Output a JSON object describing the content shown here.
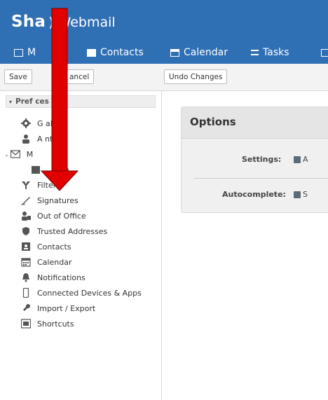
{
  "app": {
    "brand_part1": "Sha",
    "brand_part2": ") Webmail",
    "accent_color": "#2f6fb4",
    "arrow_color": "#e00000"
  },
  "nav": {
    "tabs": [
      {
        "label": "M",
        "icon": "envelope-icon"
      },
      {
        "label": "Contacts",
        "icon": "contact-card-icon"
      },
      {
        "label": "Calendar",
        "icon": "calendar-icon"
      },
      {
        "label": "Tasks",
        "icon": "tasks-icon"
      }
    ]
  },
  "toolbar": {
    "save_label": "Save",
    "cancel_label": "ancel",
    "undo_label": "Undo Changes"
  },
  "sidebar": {
    "header": "Pref    ces",
    "items": [
      {
        "label": "G    al",
        "icon": "gear-icon"
      },
      {
        "label": "A    nts",
        "icon": "accounts-icon"
      },
      {
        "label": "M",
        "icon": "envelope-icon"
      },
      {
        "label": "m",
        "icon": "compose-icon"
      },
      {
        "label": "Filters",
        "icon": "filter-icon"
      },
      {
        "label": "Signatures",
        "icon": "signature-pen-icon"
      },
      {
        "label": "Out of Office",
        "icon": "out-of-office-icon"
      },
      {
        "label": "Trusted Addresses",
        "icon": "shield-icon"
      },
      {
        "label": "Contacts",
        "icon": "contact-card-icon"
      },
      {
        "label": "Calendar",
        "icon": "calendar-icon"
      },
      {
        "label": "Notifications",
        "icon": "bell-icon"
      },
      {
        "label": "Connected Devices & Apps",
        "icon": "device-icon"
      },
      {
        "label": "Import / Export",
        "icon": "import-export-icon"
      },
      {
        "label": "Shortcuts",
        "icon": "keyboard-icon"
      }
    ]
  },
  "options": {
    "title": "Options",
    "settings_label": "Settings:",
    "settings_value": "A",
    "autocomplete_label": "Autocomplete:",
    "autocomplete_value": "S"
  }
}
